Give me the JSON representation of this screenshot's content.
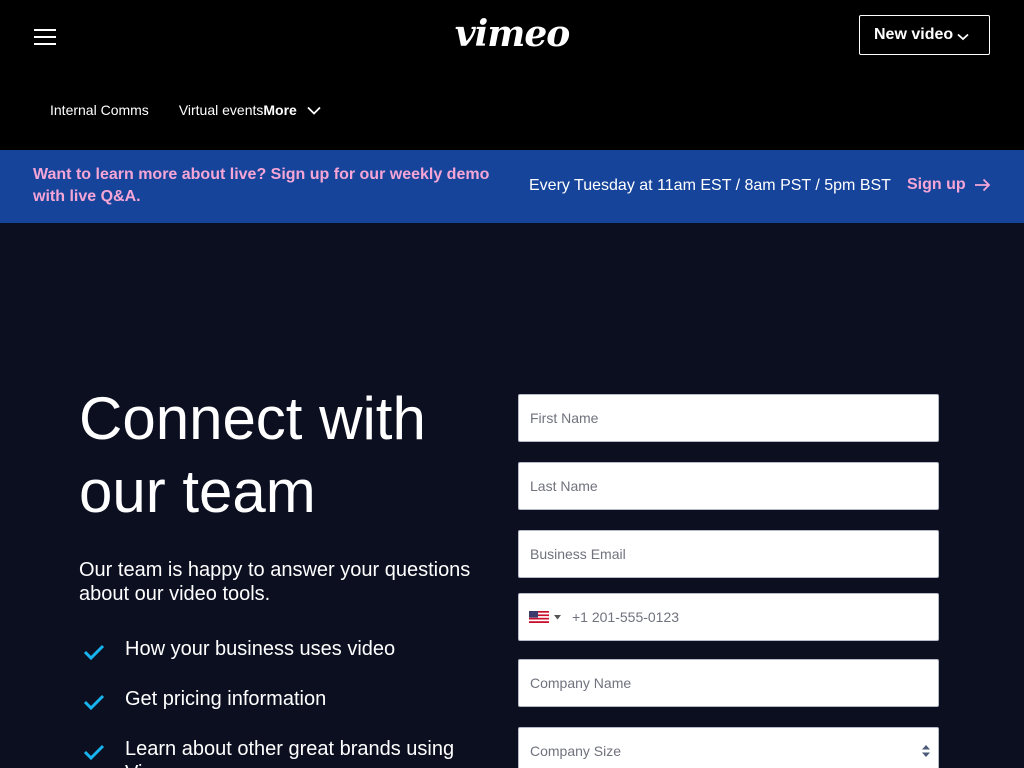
{
  "header": {
    "logo_text": "vimeo",
    "new_video_label": "New video"
  },
  "subnav": {
    "items": [
      "Internal Comms",
      "Virtual events"
    ],
    "more_label": "More"
  },
  "banner": {
    "promo_text": "Want to learn more about live? Sign up for our weekly demo with live Q&A.",
    "schedule_text": "Every Tuesday at 11am EST / 8am PST / 5pm BST",
    "signup_label": "Sign up"
  },
  "hero": {
    "title": "Connect with our team",
    "subtitle": "Our team is happy to answer your questions about our video tools.",
    "bullets": [
      "How your business uses video",
      "Get pricing information",
      "Learn about other great brands using Vimeo"
    ]
  },
  "form": {
    "first_name_placeholder": "First Name",
    "last_name_placeholder": "Last Name",
    "email_placeholder": "Business Email",
    "phone_placeholder": "+1 201-555-0123",
    "company_name_placeholder": "Company Name",
    "company_size_placeholder": "Company Size"
  },
  "colors": {
    "topbar_bg": "#000000",
    "banner_bg": "#17449b",
    "banner_accent": "#f5a6d6",
    "page_bg": "#0c0f20",
    "check_color": "#17b4f0"
  },
  "icons": {
    "menu": "hamburger-icon",
    "chevron": "chevron-down-icon",
    "arrow": "arrow-right-icon",
    "check": "check-icon",
    "flag": "us-flag-icon"
  }
}
